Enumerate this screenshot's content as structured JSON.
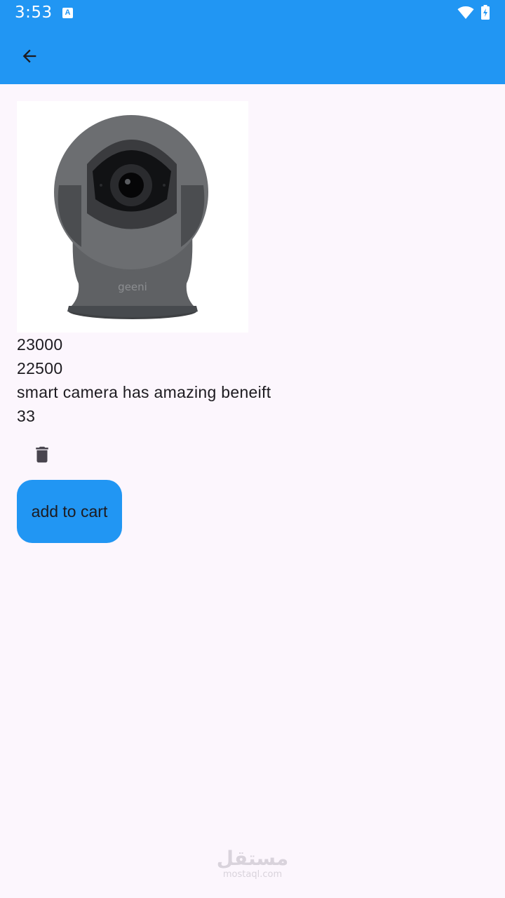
{
  "status_bar": {
    "time": "3:53",
    "notification_letter": "A",
    "icons": [
      "a-notification-icon",
      "wifi-icon",
      "battery-charging-icon"
    ]
  },
  "app_bar": {
    "back_icon": "arrow-back-icon",
    "color": "#2196f3"
  },
  "product": {
    "image_icon": "camera-image",
    "image_logo_text": "geeni",
    "price": "23000",
    "discount_price": "22500",
    "description": "smart camera has amazing beneift",
    "quantity": "33"
  },
  "actions": {
    "delete_icon": "trash-icon",
    "add_to_cart_label": "add to cart",
    "button_color": "#2196f3"
  },
  "watermark": {
    "arabic": "مستقل",
    "latin": "mostaql.com"
  }
}
